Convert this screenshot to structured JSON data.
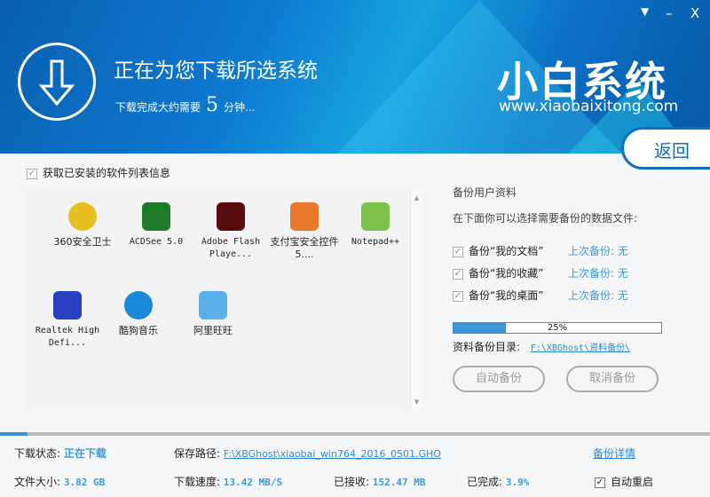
{
  "window": {
    "menu_icon": "dropdown-icon",
    "minimize": "–",
    "close": "X"
  },
  "header": {
    "title": "正在为您下载所选系统",
    "sub_prefix": "下载完成大约需要",
    "minutes": "5",
    "sub_suffix": "分钟...",
    "brand": "小白系统",
    "url": "www.xiaobaixitong.com",
    "back": "返回",
    "colors": {
      "header": "#0d79cf",
      "accent": "#3b9ad6"
    }
  },
  "software": {
    "checkbox_label": "获取已安装的软件列表信息",
    "checked": true,
    "items": [
      {
        "name": "360安全卫士",
        "icon": "360-icon",
        "color": "#e8c020"
      },
      {
        "name": "ACDSee 5.0",
        "icon": "acdsee-eye-icon",
        "color": "#1f7a2a"
      },
      {
        "name": "Adobe Flash Playe...",
        "icon": "flash-icon",
        "color": "#5a0d0d"
      },
      {
        "name": "支付宝安全控件 5....",
        "icon": "alipay-shield-icon",
        "color": "#e8792a"
      },
      {
        "name": "Notepad++",
        "icon": "notepad-icon",
        "color": "#7cc24a"
      },
      {
        "name": "Realtek High Defi...",
        "icon": "realtek-crab-icon",
        "color": "#2a3fc0"
      },
      {
        "name": "酷狗音乐",
        "icon": "kugou-icon",
        "color": "#1a8ad8"
      },
      {
        "name": "阿里旺旺",
        "icon": "aliwangwang-icon",
        "color": "#5ab0e8"
      }
    ]
  },
  "backup": {
    "title": "备份用户资料",
    "desc": "在下面你可以选择需要备份的数据文件:",
    "items": [
      {
        "label": "备份“我的文档”",
        "last": "上次备份: 无",
        "checked": true
      },
      {
        "label": "备份“我的收藏”",
        "last": "上次备份: 无",
        "checked": true
      },
      {
        "label": "备份“我的桌面”",
        "last": "上次备份: 无",
        "checked": true
      }
    ],
    "progress_percent": 25,
    "progress_text": "25%",
    "dir_label": "资料备份目录:",
    "dir": "F:\\XBGhost\\资料备份\\",
    "auto_btn": "自动备份",
    "cancel_btn": "取消备份"
  },
  "status": {
    "download_progress_percent": 3.9,
    "state_label": "下载状态:",
    "state": "正在下载",
    "path_label": "保存路径:",
    "path": "F:\\XBGhost\\xiaobai_win764_2016_0501.GHO",
    "details": "备份详情",
    "size_label": "文件大小:",
    "size": "3.82 GB",
    "speed_label": "下载速度:",
    "speed": "13.42 MB/S",
    "recv_label": "已接收:",
    "recv": "152.47 MB",
    "done_label": "已完成:",
    "done": "3.9%",
    "reboot_label": "自动重启",
    "reboot_checked": true
  }
}
